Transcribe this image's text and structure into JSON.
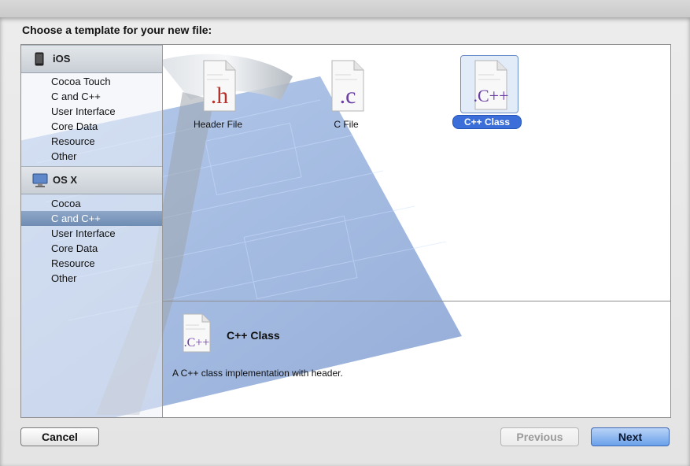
{
  "sheet": {
    "title": "Choose a template for your new file:"
  },
  "sidebar": {
    "sections": [
      {
        "label": "iOS",
        "icon": "iphone-icon",
        "items": [
          "Cocoa Touch",
          "C and C++",
          "User Interface",
          "Core Data",
          "Resource",
          "Other"
        ]
      },
      {
        "label": "OS X",
        "icon": "mac-icon",
        "items": [
          "Cocoa",
          "C and C++",
          "User Interface",
          "Core Data",
          "Resource",
          "Other"
        ]
      }
    ],
    "selected": "OS X / C and C++"
  },
  "templates": [
    {
      "label": "Header File",
      "glyph": ".h",
      "color": "#b8322c"
    },
    {
      "label": "C File",
      "glyph": ".c",
      "color": "#6a3fa3"
    },
    {
      "label": "C++ Class",
      "glyph": ".C++",
      "color": "#6a3fa3",
      "selected": true
    }
  ],
  "detail": {
    "title": "C++ Class",
    "description": "A C++ class implementation with header.",
    "glyph": ".C++"
  },
  "buttons": {
    "cancel": "Cancel",
    "previous": "Previous",
    "next": "Next"
  },
  "colors": {
    "selection": "#3b6ed8",
    "blueprint": "#4f7cc9"
  }
}
